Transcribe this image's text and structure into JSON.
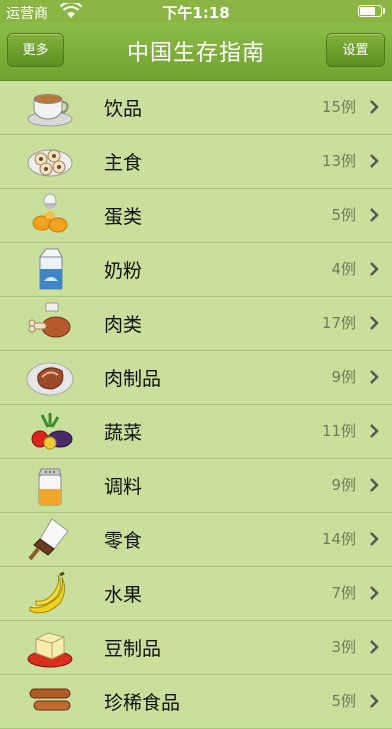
{
  "status": {
    "carrier": "运营商",
    "time": "下午1:18"
  },
  "nav": {
    "title": "中国生存指南",
    "left_label": "更多",
    "right_label": "设置"
  },
  "items": [
    {
      "label": "饮品",
      "count": "15例",
      "icon": "coffee-cup-icon"
    },
    {
      "label": "主食",
      "count": "13例",
      "icon": "dumplings-icon"
    },
    {
      "label": "蛋类",
      "count": "5例",
      "icon": "eggs-icon"
    },
    {
      "label": "奶粉",
      "count": "4例",
      "icon": "milk-carton-icon"
    },
    {
      "label": "肉类",
      "count": "17例",
      "icon": "meat-leg-icon"
    },
    {
      "label": "肉制品",
      "count": "9例",
      "icon": "ham-plate-icon"
    },
    {
      "label": "蔬菜",
      "count": "11例",
      "icon": "vegetables-icon"
    },
    {
      "label": "调料",
      "count": "9例",
      "icon": "salt-shaker-icon"
    },
    {
      "label": "零食",
      "count": "14例",
      "icon": "ice-cream-icon"
    },
    {
      "label": "水果",
      "count": "7例",
      "icon": "bananas-icon"
    },
    {
      "label": "豆制品",
      "count": "3例",
      "icon": "tofu-icon"
    },
    {
      "label": "珍稀食品",
      "count": "5例",
      "icon": "sausages-icon"
    }
  ]
}
